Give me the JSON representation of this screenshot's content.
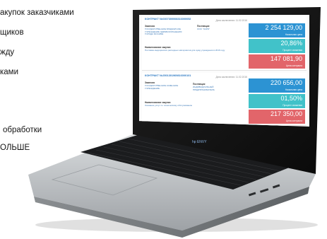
{
  "background_text": {
    "line1": "акупок заказчиками",
    "line2": "щиков",
    "line3": "жду",
    "line4": "ками",
    "line5": "обработки",
    "line6": "ОЛЬШЕ"
  },
  "screen": {
    "cards": [
      {
        "title": "КОНТРАКТ №0307300008316000052",
        "date": "Дата заключения: 11.02.2016",
        "customer_label": "Заказчик",
        "customer_text": "ГОСУДАРСТВЕННОЕ БЮДЖЕТНОЕ УЧРЕЖДЕНИЕ ЗДРАВООХРАНЕНИЯ ГОРОДА МОСКВЫ",
        "supplier_label": "Поставщик",
        "supplier_text": "ООО \"ЗАРЯ\"",
        "subject_label": "Наименование закупки",
        "subject_text": "Поставка медицинских расходных материалов для нужд учреждения в 2016 году",
        "tiles": [
          {
            "value": "2 254 129,00",
            "caption": "Начальная цена",
            "color": "#2c93d3"
          },
          {
            "value": "20,86%",
            "caption": "Процент снижения",
            "color": "#41c2c9"
          },
          {
            "value": "147 081,90",
            "caption": "Цена контракта",
            "color": "#e2656a"
          }
        ]
      },
      {
        "title": "КОНТРАКТ №2501301969816000101",
        "date": "Дата заключения: 11.02.2016",
        "customer_label": "Заказчик",
        "customer_text": "ГОСУДАРСТВЕННОЕ КАЗЕННОЕ УЧРЕЖДЕНИЕ",
        "supplier_label": "Поставщик",
        "supplier_text": "ИНДИВИДУАЛЬНЫЙ ПРЕДПРИНИМАТЕЛЬ",
        "subject_label": "Наименование закупки",
        "subject_text": "Оказание услуг по техническому обслуживанию",
        "tiles": [
          {
            "value": "220 656,00",
            "caption": "Начальная цена",
            "color": "#2c93d3"
          },
          {
            "value": "01,50%",
            "caption": "Процент снижения",
            "color": "#41c2c9"
          },
          {
            "value": "217 350,00",
            "caption": "Цена контракта",
            "color": "#e2656a"
          }
        ]
      }
    ]
  }
}
